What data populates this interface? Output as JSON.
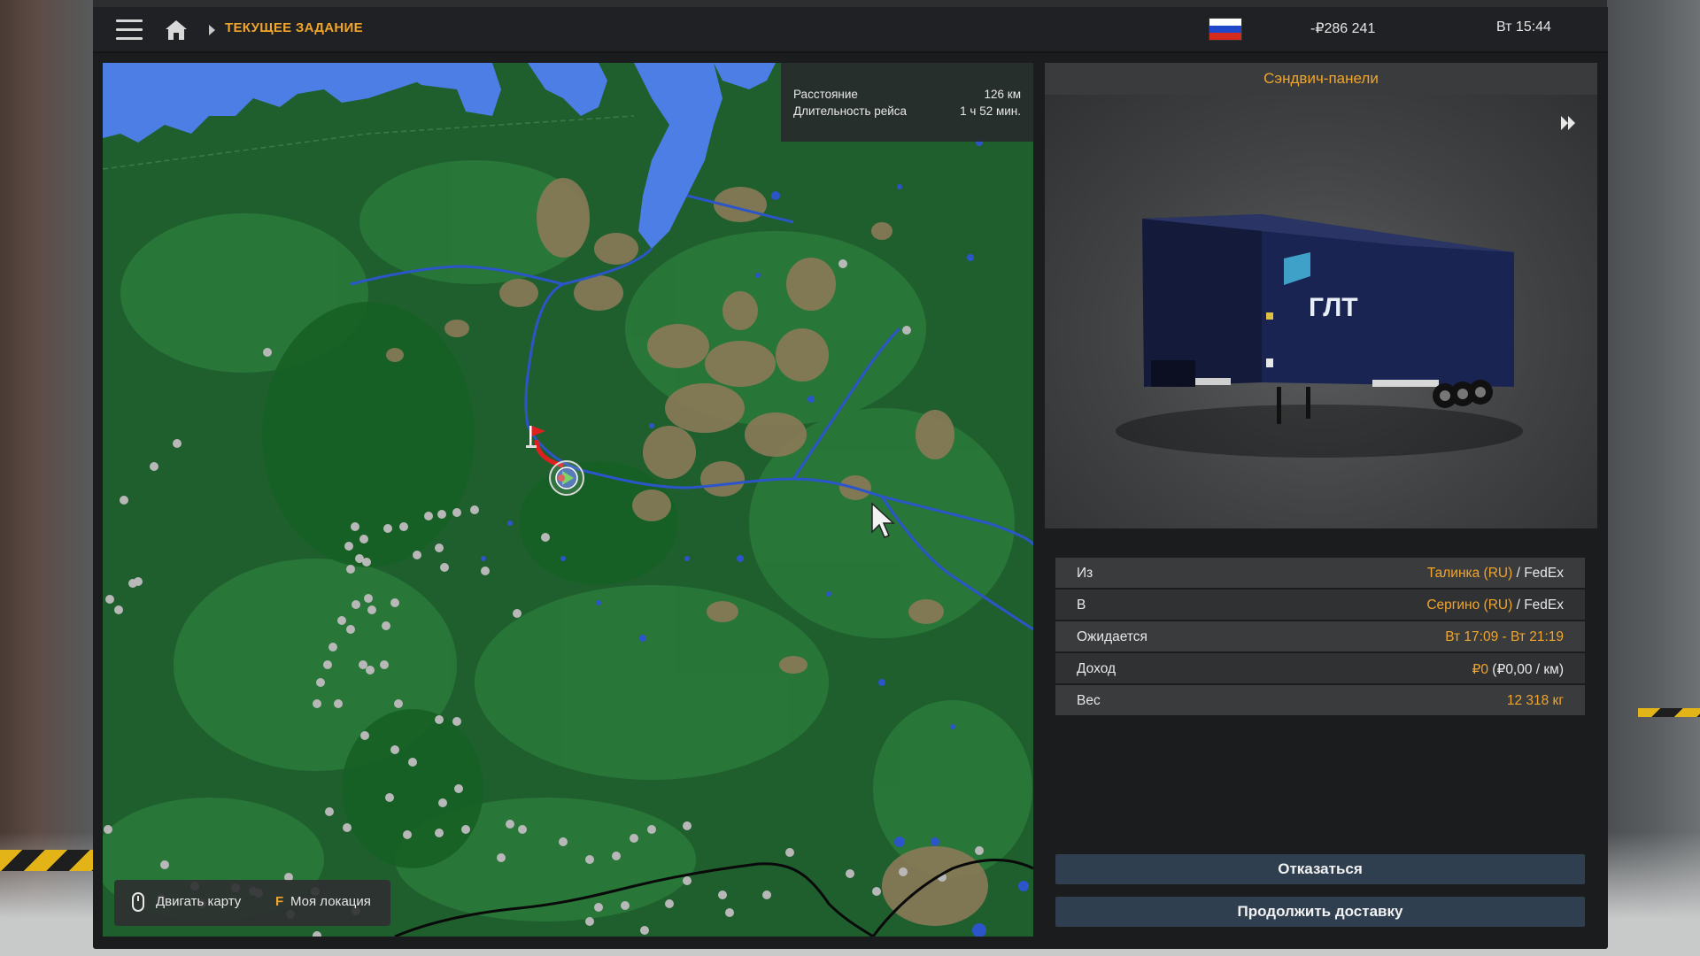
{
  "header": {
    "breadcrumb": "ТЕКУЩЕЕ ЗАДАНИЕ",
    "money": "-₽286 241",
    "clock": "Вт 15:44",
    "flag": "russia-flag-icon"
  },
  "route_info": {
    "distance_label": "Расстояние",
    "distance_value": "126 км",
    "duration_label": "Длительность рейса",
    "duration_value": "1 ч 52 мин."
  },
  "map_controls": {
    "move_map": "Двигать карту",
    "key_f": "F",
    "my_location": "Моя локация"
  },
  "cargo": {
    "title": "Сэндвич-панели"
  },
  "details": {
    "from_label": "Из",
    "from_city": "Талинка (RU)",
    "from_sep": " / ",
    "from_company": "FedEx",
    "to_label": "В",
    "to_city": "Сергино (RU)",
    "to_sep": " / ",
    "to_company": "FedEx",
    "expected_label": "Ожидается",
    "expected_value": "Вт 17:09 - Вт 21:19",
    "income_label": "Доход",
    "income_value": "₽0",
    "income_rate": " (₽0,00 / км)",
    "weight_label": "Вес",
    "weight_value": "12 318 кг"
  },
  "buttons": {
    "decline": "Отказаться",
    "continue": "Продолжить доставку"
  },
  "colors": {
    "accent": "#f0a52c",
    "map_forest": "#1f5f2e",
    "map_water": "#4c7ee6",
    "route": "#e02020"
  }
}
